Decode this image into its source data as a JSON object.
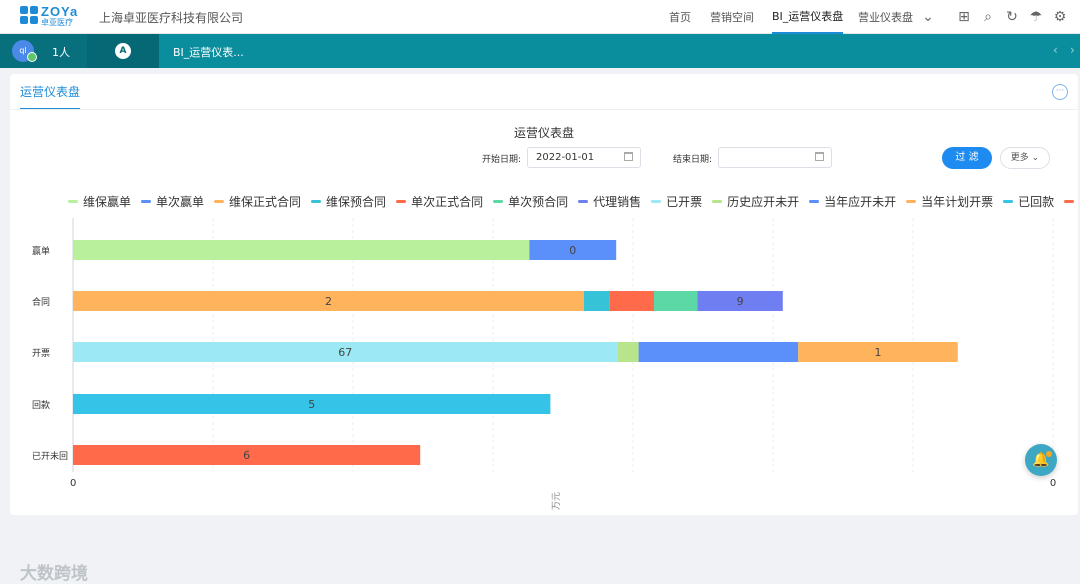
{
  "header": {
    "logo_text": "ZOYa",
    "logo_sub": "卓亚医疗",
    "company": "上海卓亚医疗科技有限公司",
    "nav": [
      "首页",
      "营销空间",
      "BI_运营仪表盘",
      "营业仪表盘"
    ],
    "active_nav": "BI_运营仪表盘",
    "icons": [
      "apps-icon",
      "search-icon",
      "refresh-icon",
      "skin-icon",
      "settings-icon"
    ]
  },
  "tabbar": {
    "avatar_text": "ql",
    "user_count": "1人",
    "home_label": "A",
    "current_tab": "BI_运营仪表..."
  },
  "panel": {
    "tab_label": "运营仪表盘",
    "title": "运营仪表盘",
    "start_label": "开始日期:",
    "start_value": "2022-01-01",
    "end_label": "结束日期:",
    "end_value": "",
    "filter_label": "过 滤",
    "more_label": "更多 ⌄"
  },
  "legend": [
    {
      "name": "维保赢单",
      "color": "#b8f09c"
    },
    {
      "name": "单次赢单",
      "color": "#5b8ff9"
    },
    {
      "name": "维保正式合同",
      "color": "#ffb35c"
    },
    {
      "name": "维保预合同",
      "color": "#36c3d8"
    },
    {
      "name": "单次正式合同",
      "color": "#ff6b4a"
    },
    {
      "name": "单次预合同",
      "color": "#5bd8a6"
    },
    {
      "name": "代理销售",
      "color": "#6f7ef0"
    },
    {
      "name": "已开票",
      "color": "#9ce8f5"
    },
    {
      "name": "历史应开未开",
      "color": "#b8e58b"
    },
    {
      "name": "当年应开未开",
      "color": "#5b8ff9"
    },
    {
      "name": "当年计划开票",
      "color": "#ffb35c"
    },
    {
      "name": "已回款",
      "color": "#36c3e8"
    },
    {
      "name": "已开未回",
      "color": "#ff6b4a"
    }
  ],
  "chart_data": {
    "type": "bar",
    "orientation": "horizontal",
    "stacked": true,
    "categories": [
      "赢单",
      "合同",
      "开票",
      "回款",
      "已开未回"
    ],
    "x_ticks": [
      "0",
      "",
      "",
      "",
      "",
      "",
      "",
      "0"
    ],
    "xlim": [
      0,
      7
    ],
    "series": [
      {
        "name": "维保赢单",
        "values": [
          3.26,
          0,
          0,
          0,
          0
        ]
      },
      {
        "name": "单次赢单",
        "values": [
          0.62,
          0,
          0,
          0,
          0
        ]
      },
      {
        "name": "维保正式合同",
        "values": [
          0,
          3.65,
          0,
          0,
          0
        ]
      },
      {
        "name": "维保预合同",
        "values": [
          0,
          0.18,
          0,
          0,
          0
        ]
      },
      {
        "name": "单次正式合同",
        "values": [
          0,
          0.32,
          0,
          0,
          0
        ]
      },
      {
        "name": "单次预合同",
        "values": [
          0,
          0.31,
          0,
          0,
          0
        ]
      },
      {
        "name": "代理销售",
        "values": [
          0,
          0.61,
          0,
          0,
          0
        ]
      },
      {
        "name": "已开票",
        "values": [
          0,
          0,
          3.89,
          0,
          0
        ]
      },
      {
        "name": "历史应开未开",
        "values": [
          0,
          0,
          0.15,
          0,
          0
        ]
      },
      {
        "name": "当年应开未开",
        "values": [
          0,
          0,
          1.14,
          0,
          0
        ]
      },
      {
        "name": "当年计划开票",
        "values": [
          0,
          0,
          1.14,
          0,
          0
        ]
      },
      {
        "name": "已回款",
        "values": [
          0,
          0,
          0,
          3.41,
          0
        ]
      },
      {
        "name": "已开未回",
        "values": [
          0,
          0,
          0,
          0,
          2.48
        ]
      }
    ],
    "data_labels": [
      {
        "category": "赢单",
        "text": "0",
        "series": "单次赢单"
      },
      {
        "category": "合同",
        "text": "2",
        "series": "维保正式合同"
      },
      {
        "category": "合同",
        "text": "9",
        "series": "代理销售"
      },
      {
        "category": "开票",
        "text": "67",
        "series": "已开票"
      },
      {
        "category": "开票",
        "text": "1",
        "series": "当年计划开票"
      },
      {
        "category": "回款",
        "text": "5",
        "series": "已回款"
      },
      {
        "category": "已开未回",
        "text": "6",
        "series": "已开未回"
      }
    ],
    "axis_unit": "万元"
  },
  "watermark": "大数跨境"
}
